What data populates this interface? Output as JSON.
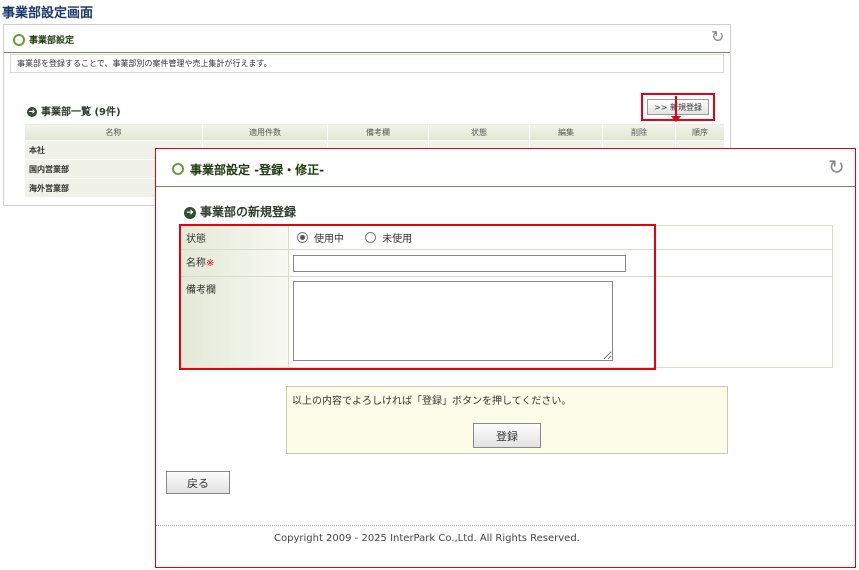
{
  "page_title": "事業部設定画面",
  "back_panel": {
    "title": "事業部設定",
    "refresh_icon": "↻",
    "description": "事業部を登録することで、事業部別の案件管理や売上集計が行えます。",
    "list_title": "事業部一覧 (9件)",
    "new_button": ">> 新規登録",
    "columns": [
      "名称",
      "適用件数",
      "備考欄",
      "状態",
      "編集",
      "削除",
      "順序"
    ],
    "rows": [
      "本社",
      "国内営業部",
      "海外営業部"
    ]
  },
  "front_panel": {
    "title": "事業部設定 -登録・修正-",
    "refresh_icon": "↻",
    "section_title": "事業部の新規登録",
    "fields": {
      "status_label": "状態",
      "status_options": [
        "使用中",
        "未使用"
      ],
      "status_selected": "使用中",
      "name_label": "名称",
      "name_required_mark": "※",
      "name_value": "",
      "memo_label": "備考欄",
      "memo_value": ""
    },
    "confirm_text": "以上の内容でよろしければ「登録」ボタンを押してください。",
    "submit_button": "登録",
    "back_button": "戻る",
    "footer": "Copyright 2009 - 2025 InterPark Co.,Ltd. All Rights Reserved."
  },
  "colors": {
    "highlight": "#e60012",
    "title_text": "#1a3a6e",
    "accent_green": "#6a9a3c"
  }
}
